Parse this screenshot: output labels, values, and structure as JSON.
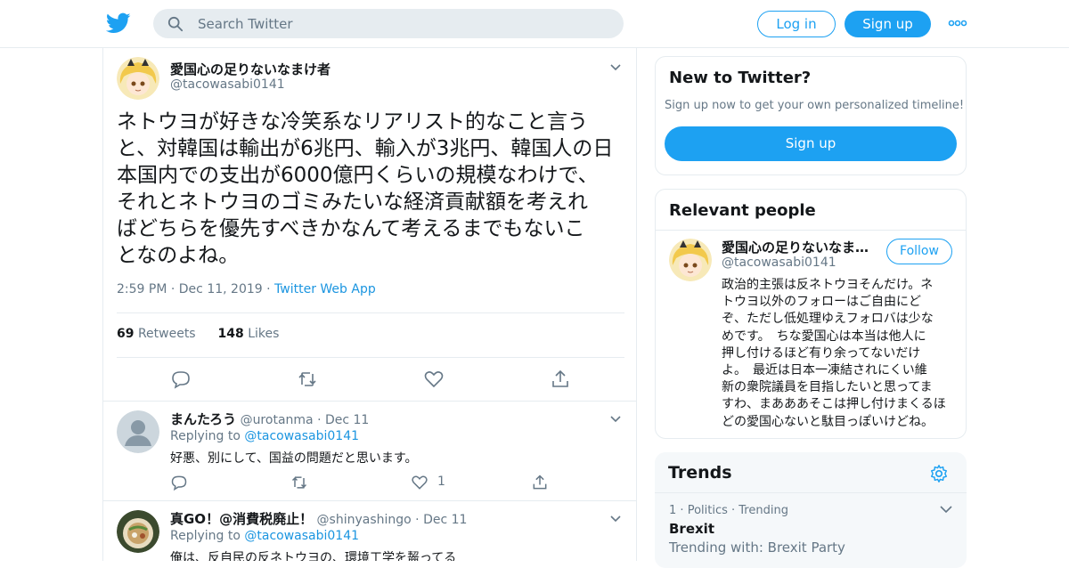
{
  "header": {
    "logo": "twitter-bird-icon",
    "search_placeholder": "Search Twitter",
    "login_label": "Log in",
    "signup_label": "Sign up",
    "more_icon": "more-dots-icon"
  },
  "tweet": {
    "author_name": "愛国心の足りないなまけ者",
    "author_handle": "@tacowasabi0141",
    "lines": [
      "ネトウヨが好きな冷笑系なリアリスト的なこと言う",
      "と、対韓国は輸出が6兆円、輸入が3兆円、韓国人の日",
      "本国内での支出が6000億円くらいの規模なわけで、",
      "それとネトウヨのゴミみたいな経済貢献額を考えれ",
      "ばどちらを優先すべきかなんて考えるまでもないこ",
      "となのよね。"
    ],
    "time": "2:59 PM",
    "date": "Dec 11, 2019",
    "source": "Twitter Web App",
    "retweets_count": "69",
    "retweets_label": "Retweets",
    "likes_count": "148",
    "likes_label": "Likes"
  },
  "replies": [
    {
      "name": "まんたろう",
      "handle": "@urotanma",
      "date": "Dec 11",
      "replying_label": "Replying to",
      "replying_to": "@tacowasabi0141",
      "text": "好悪、別にして、国益の問題だと思います。",
      "likes": "1"
    },
    {
      "name": "真GO！@消費税廃止！",
      "handle": "@shinyashingo",
      "date": "Dec 11",
      "replying_label": "Replying to",
      "replying_to": "@tacowasabi0141",
      "text": "俺は、反自民の反ネトウヨの、環境工学を齧ってる"
    }
  ],
  "new_to_twitter": {
    "title": "New to Twitter?",
    "subtitle": "Sign up now to get your own personalized timeline!",
    "signup_label": "Sign up"
  },
  "relevant_people": {
    "title": "Relevant people",
    "name": "愛国心の足りないなまけ者",
    "handle": "@tacowasabi0141",
    "follow_label": "Follow",
    "bio_lines": [
      "政治的主張は反ネトウヨそんだけ。ネ",
      "トウヨ以外のフォローはご自由にど",
      "ぞ、ただし低処理ゆえフォロバは少な",
      "めです。　ちな愛国心は本当は他人に",
      "押し付けるほど有り余ってないだけ",
      "よ。　最近は日本一凍結されにくい維",
      "新の衆院議員を目指したいと思ってま",
      "すわ、まあああそこは押し付けまくるほ",
      "どの愛国心ないと駄目っぽいけどね。"
    ]
  },
  "trends": {
    "title": "Trends",
    "items": [
      {
        "rank": "1",
        "category": "Politics",
        "status": "Trending",
        "name": "Brexit",
        "trending_with": "Trending with: Brexit Party"
      }
    ]
  },
  "colors": {
    "accent": "#1da1f2",
    "link": "#1b95e0",
    "muted": "#657786",
    "border": "#e6ecf0"
  }
}
